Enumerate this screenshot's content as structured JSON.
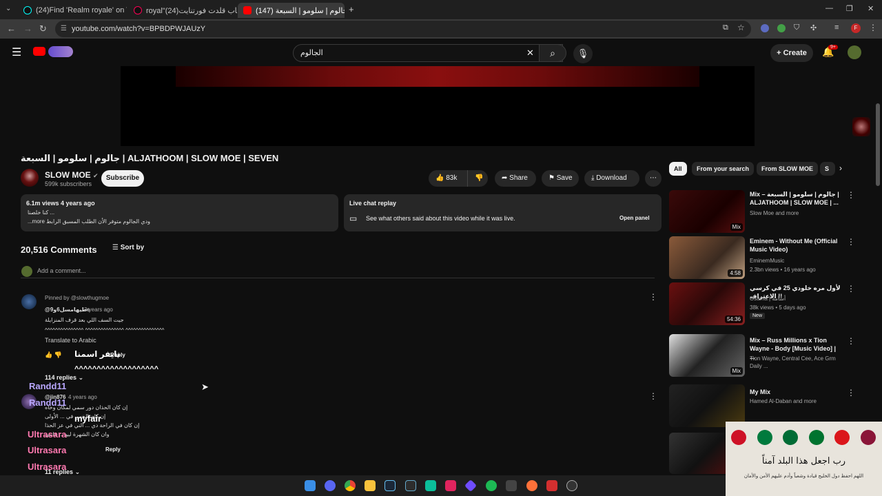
{
  "browser": {
    "tabs": [
      {
        "title": "(24)Find 'Realm royale' on TikTo"
      },
      {
        "title": "royal\"العاب قلدت فورتنايت(24)"
      },
      {
        "title": "(147) جالوم | سلومو | السبعة"
      }
    ],
    "url": "youtube.com/watch?v=BPBDPWJAUzY"
  },
  "youtube": {
    "search_value": "الجالوم",
    "create_label": "Create",
    "notif_count": "9+"
  },
  "video": {
    "title": "جالوم | سلومو | السبعة | ALJATHOOM | SLOW MOE | SEVEN",
    "channel": "SLOW MOE",
    "subscribers": "599k subscribers",
    "subscribe_label": "Subscribe",
    "likes": "83k",
    "share_label": "Share",
    "save_label": "Save",
    "download_label": "Download",
    "views_date": "6.1m views  4 years ago",
    "desc_line1": "كنا خلصنا ...",
    "desc_line2": "...more  ودي الجالوم متوفر الأن الطلب المسبق الرابط",
    "live_chat_title": "Live chat replay",
    "live_chat_text": "See what others said about this video while it was live.",
    "open_panel_label": "Open panel"
  },
  "comments": {
    "count": "20,516 Comments",
    "sort_label": "Sort by",
    "add_placeholder": "Add a comment...",
    "pinned": {
      "pinned_by": "Pinned by @slowthugmoe",
      "author": "@طيهامسل6و9e",
      "time": "3 years ago",
      "line1": "جيت السف اللي بعد قرف المنزايلة",
      "line2": "^^^^^^^^^^^^^^^ ^^^^^^^^^^^^^^^ ^^^^^^^^^^^^^^^",
      "translate": "Translate to Arabic",
      "reply_label": "Reply",
      "replies": "114 replies"
    },
    "second": {
      "author": "@jin876",
      "time": "4 years ago",
      "line1": "إن كان الحذان دور سمي لمكان وخاه",
      "line2": "إن كان الخس في ... الأولى",
      "line3": "إن كان في الراحة دي ... الني في عز الحذا",
      "line4": "وان كان الشهرة ليو ... عايني",
      "reply_label": "Reply",
      "replies": "11 replies"
    },
    "overlays": [
      "Randd11",
      "Randd11",
      "myfair",
      "Ultrasara",
      "Ultrasara",
      "Ultrasara",
      "نايفر اسمنا",
      "^^^^^^^^^^^^^^^^^^^"
    ]
  },
  "sidebar": {
    "chips": [
      "All",
      "From your search",
      "From SLOW MOE",
      "S"
    ],
    "items": [
      {
        "title": "Mix – جالوم | سلومو | السبعة | ALJATHOOM | SLOW MOE | ...",
        "meta1": "Slow Moe and more",
        "meta2": "",
        "badge": "Mix"
      },
      {
        "title": "Eminem - Without Me (Official Music Video)",
        "meta1": "EminemMusic",
        "meta2": "2.3bn views • 16 years ago",
        "badge": "4:58"
      },
      {
        "title": "لأول مره خلودي 25 في كرسي الاعتراف !!",
        "meta1": "Osama | أسامة",
        "meta2": "38k views • 5 days ago",
        "badge": "54:36",
        "tag": "New"
      },
      {
        "title": "Mix – Russ Millions x Tion Wayne - Body [Music Video] | ...",
        "meta1": "Tion Wayne, Central Cee, Ace Grm Daily ...",
        "meta2": "",
        "badge": "Mix"
      },
      {
        "title": "My Mix",
        "meta1": "Hamed Al-Daban and more",
        "meta2": "",
        "badge": ""
      }
    ]
  },
  "banner": {
    "line1": "رب اجعل هذا البلد آمناً",
    "line2": "اللهم احفظ دول الخليج قيادة وشعباً وأدم عليهم الأمن والأمان"
  }
}
